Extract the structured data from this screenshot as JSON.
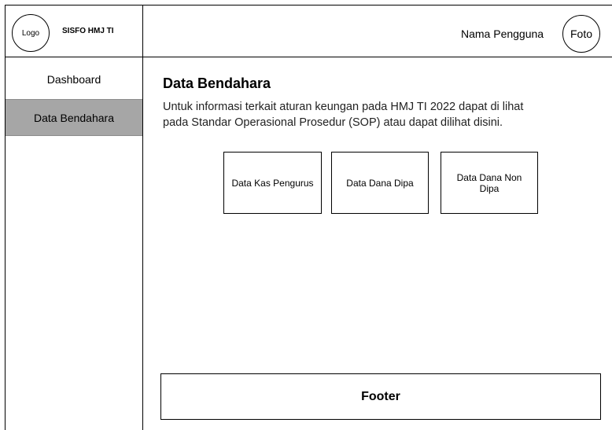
{
  "header": {
    "logo_label": "Logo",
    "app_title": "SISFO HMJ TI",
    "user_name": "Nama Pengguna",
    "avatar_label": "Foto"
  },
  "sidebar": {
    "items": [
      {
        "label": "Dashboard",
        "active": false
      },
      {
        "label": "Data Bendahara",
        "active": true
      }
    ]
  },
  "main": {
    "title": "Data Bendahara",
    "description_line1": "Untuk informasi terkait aturan keungan pada HMJ TI 2022 dapat di lihat",
    "description_line2": "pada Standar Operasional Prosedur (SOP) atau dapat dilihat disini.",
    "cards": [
      {
        "label": "Data Kas Pengurus"
      },
      {
        "label": "Data Dana Dipa"
      },
      {
        "label": "Data Dana Non Dipa"
      }
    ]
  },
  "footer": {
    "label": "Footer"
  },
  "colors": {
    "active_sidebar_bg": "#a6a6a6",
    "border": "#000000"
  }
}
